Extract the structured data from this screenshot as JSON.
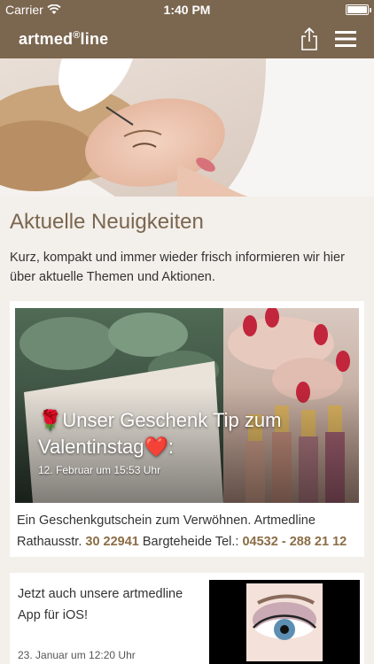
{
  "status_bar": {
    "carrier": "Carrier",
    "time": "1:40 PM"
  },
  "navbar": {
    "brand_name": "artmed",
    "brand_mark": "®",
    "brand_suffix": "line",
    "share_icon": "share-icon",
    "menu_icon": "hamburger-menu-icon"
  },
  "page": {
    "title": "Aktuelle Neuigkeiten",
    "intro": "Kurz, kompakt und immer wieder frisch informieren wir hier über aktuelle Themen und Aktionen."
  },
  "posts": [
    {
      "emoji_left": "🌹",
      "title_text": "Unser Geschenk Tip zum Valentinstag",
      "emoji_right": "❤️",
      "title_suffix": ":",
      "date": "12. Februar um 15:53 Uhr",
      "desc_a": "Ein Geschenkgutschein zum Verwöhnen. Artmedline Rathausstr. ",
      "desc_b": "30 22941",
      "desc_c": " Bargteheide Tel.: ",
      "desc_d": "04532 - 288 21 12"
    },
    {
      "text": "Jetzt auch unsere artmedline App für iOS!",
      "date": "23. Januar um 12:20 Uhr"
    }
  ]
}
